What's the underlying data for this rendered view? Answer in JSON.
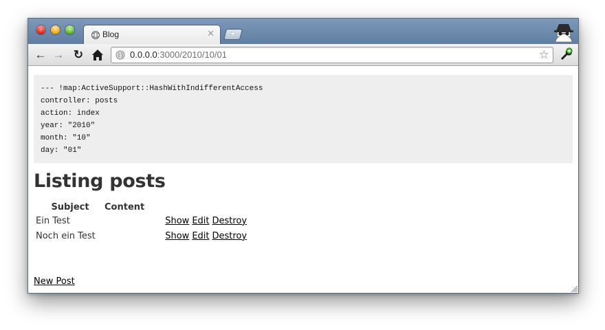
{
  "browser": {
    "tab_title": "Blog",
    "url_host": "0.0.0.0",
    "url_rest": ":3000/2010/10/01"
  },
  "params": {
    "lines": [
      "--- !map:ActiveSupport::HashWithIndifferentAccess",
      "controller: posts",
      "action: index",
      "year: \"2010\"",
      "month: \"10\"",
      "day: \"01\""
    ]
  },
  "page": {
    "heading": "Listing posts",
    "columns": [
      "Subject",
      "Content"
    ],
    "rows": [
      {
        "subject": "Ein Test",
        "content": "",
        "actions": [
          "Show",
          "Edit",
          "Destroy"
        ]
      },
      {
        "subject": "Noch ein Test",
        "content": "",
        "actions": [
          "Show",
          "Edit",
          "Destroy"
        ]
      }
    ],
    "new_post_label": "New Post"
  },
  "colors": {
    "titlebar": "#6a89ad",
    "params_background": "#eeeeee",
    "text": "#333333"
  }
}
